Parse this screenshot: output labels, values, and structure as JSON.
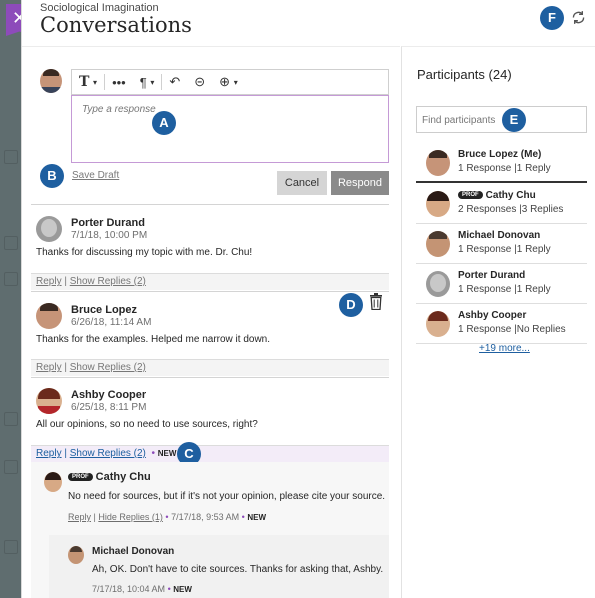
{
  "header": {
    "subtitle": "Sociological Imagination",
    "title": "Conversations",
    "close_symbol": "✕"
  },
  "callouts": {
    "a": "A",
    "b": "B",
    "c": "C",
    "d": "D",
    "e": "E",
    "f": "F"
  },
  "composer": {
    "placeholder": "Type a response",
    "save_draft": "Save Draft",
    "cancel": "Cancel",
    "respond": "Respond",
    "toolbar": {
      "text": "T",
      "more": "•••",
      "paragraph": "¶",
      "undo": "↶",
      "link": "⊝",
      "insert": "⊕",
      "caret": "▾"
    }
  },
  "posts": [
    {
      "name": "Porter Durand",
      "date": "7/1/18, 10:00 PM",
      "body": "Thanks for discussing my topic with me. Dr. Chu!",
      "reply": "Reply",
      "show_replies": "Show Replies (2)"
    },
    {
      "name": "Bruce Lopez",
      "date": "6/26/18, 11:14 AM",
      "body": "Thanks for the examples. Helped me narrow it down.",
      "reply": "Reply",
      "show_replies": "Show Replies (2)"
    },
    {
      "name": "Ashby Cooper",
      "date": "6/25/18, 8:11 PM",
      "body": "All our opinions, so no need to use sources, right?",
      "reply": "Reply",
      "show_replies": "Show Replies (2)",
      "new_label": "NEW"
    }
  ],
  "replies": [
    {
      "prof": "PROF",
      "name": "Cathy Chu",
      "body": "No need for sources, but if it's not your opinion, please cite your source.",
      "reply": "Reply",
      "hide_replies": "Hide Replies (1)",
      "date": "7/17/18, 9:53 AM",
      "new_label": "NEW"
    },
    {
      "name": "Michael Donovan",
      "body": "Ah, OK. Don't have to cite sources. Thanks for asking that, Ashby.",
      "date": "7/17/18, 10:04 AM",
      "new_label": "NEW"
    }
  ],
  "participants": {
    "title": "Participants (24)",
    "search_placeholder": "Find participants",
    "more": "+19 more...",
    "list": [
      {
        "name": "Bruce Lopez (Me)",
        "counts": "1 Response  |1 Reply"
      },
      {
        "prof": "PROF",
        "name": "Cathy Chu",
        "counts": "2 Responses  |3 Replies"
      },
      {
        "name": "Michael Donovan",
        "counts": "1 Response  |1 Reply"
      },
      {
        "name": "Porter Durand",
        "counts": "1 Response  |1 Reply"
      },
      {
        "name": "Ashby Cooper",
        "counts": "1 Response  |No Replies"
      }
    ]
  },
  "colors": {
    "accent": "#8d4bba",
    "callout": "#1e5fa0",
    "link": "#1e5fa0"
  },
  "icons": [
    "close-icon",
    "refresh-icon",
    "text-format-icon",
    "more-icon",
    "paragraph-icon",
    "undo-icon",
    "link-icon",
    "insert-icon",
    "trash-icon",
    "avatar"
  ]
}
